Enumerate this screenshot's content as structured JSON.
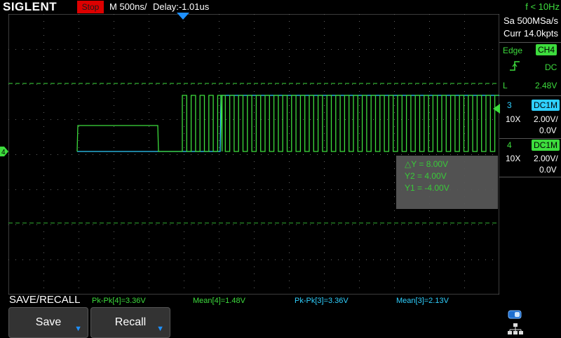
{
  "header": {
    "brand": "SIGLENT",
    "run_state": "Stop",
    "timebase": "M 500ns/",
    "delay": "Delay:-1.01us",
    "freq_counter": "f < 10Hz"
  },
  "acquisition": {
    "sample_rate": "Sa 500MSa/s",
    "memory": "Curr 14.0kpts"
  },
  "trigger": {
    "type_label": "Edge",
    "source": "CH4",
    "slope_icon": "rising-edge-icon",
    "coupling": "DC",
    "level_label": "L",
    "level_value": "2.48V"
  },
  "channels": [
    {
      "number": "3",
      "coupling": "DC1M",
      "probe": "10X",
      "scale": "2.00V/",
      "offset": "0.0V",
      "color": "#2fd0ff"
    },
    {
      "number": "4",
      "coupling": "DC1M",
      "probe": "10X",
      "scale": "2.00V/",
      "offset": "0.0V",
      "color": "#3ddc3d"
    }
  ],
  "markers": {
    "ground_left": "4"
  },
  "cursors": {
    "delta_y": "△Y = 8.00V",
    "y2": "Y2 = 4.00V",
    "y1": "Y1 = -4.00V"
  },
  "measurements": [
    {
      "text": "Pk-Pk[4]=3.36V",
      "color": "#3ddc3d"
    },
    {
      "text": "Mean[4]=1.48V",
      "color": "#3ddc3d"
    },
    {
      "text": "Pk-Pk[3]=3.36V",
      "color": "#2fd0ff"
    },
    {
      "text": "Mean[3]=2.13V",
      "color": "#2fd0ff"
    }
  ],
  "menu": {
    "title": "SAVE/RECALL",
    "buttons": [
      {
        "label": "Save",
        "icon": "chevron-down-icon"
      },
      {
        "label": "Recall",
        "icon": "chevron-down-icon"
      }
    ]
  },
  "colors": {
    "ch3": "#2fd0ff",
    "ch4": "#3ddc3d",
    "trigger_level": "#3ddc3d",
    "run_badge": "#dd0000"
  }
}
